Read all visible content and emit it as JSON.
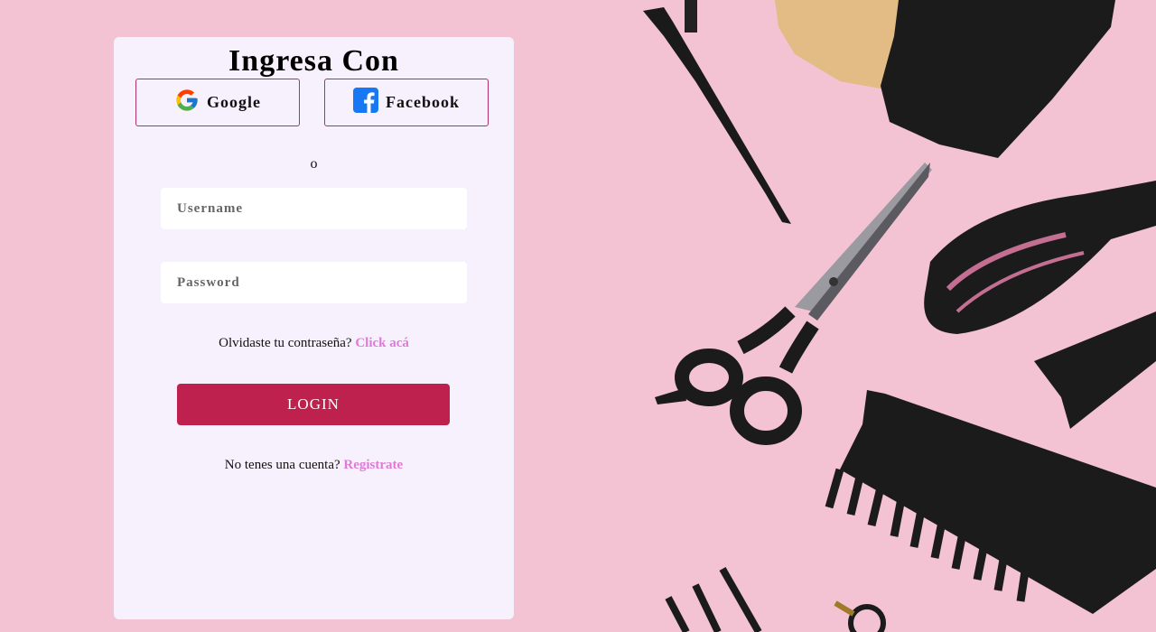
{
  "login_panel": {
    "title": "Ingresa Con",
    "google_label": "Google",
    "facebook_label": "Facebook",
    "separator": "o",
    "username_placeholder": "Username",
    "password_placeholder": "Password",
    "forgot_text": "Olvidaste tu contraseña?",
    "forgot_link": "Click acá",
    "login_label": "LOGIN",
    "signup_text": "No tenes una cuenta?",
    "signup_link": "Registrate"
  },
  "icons": {
    "google": "google-logo-icon",
    "facebook": "facebook-logo-icon"
  },
  "colors": {
    "background": "#f3c3d3",
    "panel": "#f7f0fd",
    "accent": "#be214d",
    "link": "#e07ad7",
    "social_border": "#b0306b"
  }
}
